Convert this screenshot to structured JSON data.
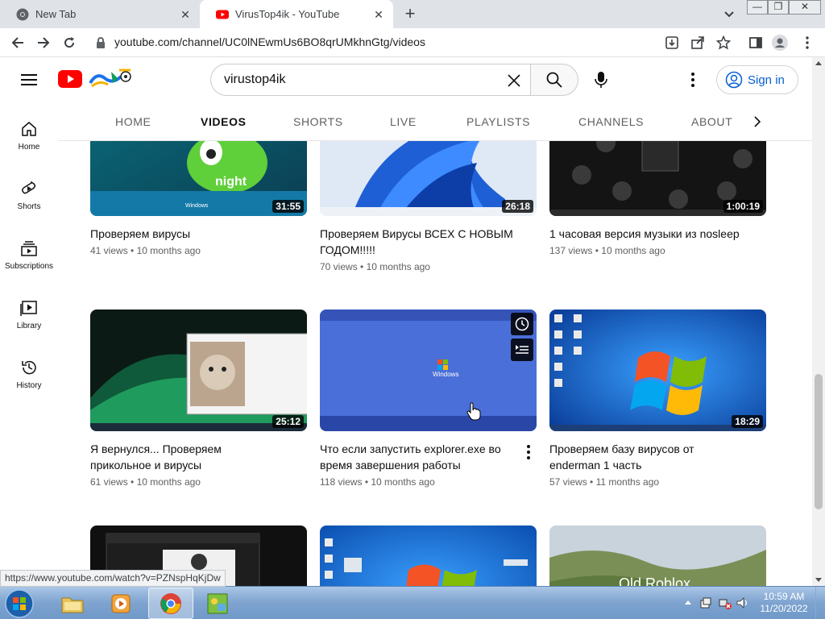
{
  "browser": {
    "tabs": [
      {
        "title": "New Tab",
        "active": false,
        "favicon": "chrome-icon"
      },
      {
        "title": "VirusTop4ik - YouTube",
        "active": true,
        "favicon": "youtube-icon"
      }
    ],
    "new_tab_symbol": "+",
    "close_symbol": "✕",
    "url": "youtube.com/channel/UC0lNEwmUs6BO8qrUMkhnGtg/videos",
    "window_controls": {
      "minimize": "—",
      "restore": "❐",
      "close": "✕"
    }
  },
  "header": {
    "search_query": "virustop4ik",
    "sign_in_label": "Sign in"
  },
  "guide": {
    "items": [
      {
        "label": "Home",
        "icon": "home-icon"
      },
      {
        "label": "Shorts",
        "icon": "shorts-icon"
      },
      {
        "label": "Subscriptions",
        "icon": "subscriptions-icon"
      },
      {
        "label": "Library",
        "icon": "library-icon"
      },
      {
        "label": "History",
        "icon": "history-icon"
      }
    ]
  },
  "channel_tabs": {
    "items": [
      "HOME",
      "VIDEOS",
      "SHORTS",
      "LIVE",
      "PLAYLISTS",
      "CHANNELS",
      "ABOUT"
    ],
    "active": "VIDEOS"
  },
  "videos": [
    {
      "title": "Проверяем вирусы",
      "views": "41 views",
      "age": "10 months ago",
      "duration": "31:55"
    },
    {
      "title": "Проверяем Вирусы ВСЕХ С НОВЫМ ГОДОМ!!!!!",
      "views": "70 views",
      "age": "10 months ago",
      "duration": "26:18"
    },
    {
      "title": "1 часовая версия музыки из nosleep",
      "views": "137 views",
      "age": "10 months ago",
      "duration": "1:00:19"
    },
    {
      "title": "Я вернулся... Проверяем прикольное и вирусы",
      "views": "61 views",
      "age": "10 months ago",
      "duration": "25:12"
    },
    {
      "title": "Что если запустить explorer.exe во время завершения работы",
      "views": "118 views",
      "age": "10 months ago",
      "duration": ""
    },
    {
      "title": "Проверяем базу вирусов от enderman 1 часть",
      "views": "57 views",
      "age": "11 months ago",
      "duration": "18:29"
    }
  ],
  "thumb_texts": {
    "night_text": "night",
    "windows_text": "Windows",
    "old_roblox_text": "Old Roblox"
  },
  "meta_separator": "•",
  "status_url": "https://www.youtube.com/watch?v=PZNspHqKjDw",
  "taskbar": {
    "time": "10:59 AM",
    "date": "11/20/2022"
  },
  "colors": {
    "youtube_red": "#ff0000",
    "link_blue": "#065fd4",
    "taskbar": "#7ea3cf"
  }
}
